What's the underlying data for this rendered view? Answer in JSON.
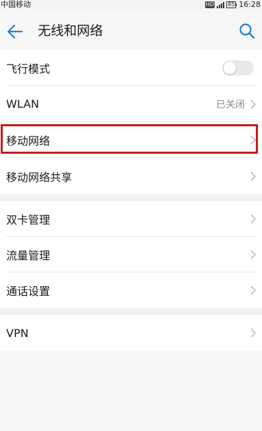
{
  "status_bar": {
    "carrier": "中国移动",
    "network_badge": "HD",
    "battery": "85",
    "time": "16:28"
  },
  "header": {
    "title": "无线和网络",
    "back_icon": "back-arrow-icon",
    "search_icon": "search-icon"
  },
  "sections": [
    {
      "items": [
        {
          "label": "飞行模式",
          "control": "toggle",
          "checked": false
        },
        {
          "label": "WLAN",
          "value": "已关闭"
        },
        {
          "label": "移动网络",
          "highlighted": true
        },
        {
          "label": "移动网络共享"
        }
      ]
    },
    {
      "items": [
        {
          "label": "双卡管理"
        },
        {
          "label": "流量管理"
        },
        {
          "label": "通话设置"
        }
      ]
    },
    {
      "items": [
        {
          "label": "VPN"
        }
      ]
    }
  ],
  "colors": {
    "accent": "#1f7ed6",
    "highlight_border": "#c41a1a",
    "background": "#f7f7f7"
  }
}
